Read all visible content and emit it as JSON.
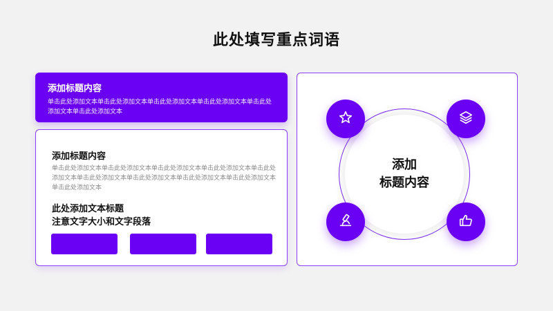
{
  "page": {
    "title": "此处填写重点词语"
  },
  "colors": {
    "accent": "#6a00f4",
    "border": "#8a3cf7",
    "background": "#f2f2f2"
  },
  "top_card": {
    "heading": "添加标题内容",
    "body": "单击此处添加文本单击此处添加文本单击此处添加文本单击此处添加文本单击此处添加文本单击此处添加文本"
  },
  "lower_card": {
    "heading": "添加标题内容",
    "body": "单击此处添加文本单击此处添加文本单击此处添加文本单击此处添加文本单击此处添加文本单击此处添加文本单击此处添加文本单击此处添加文本单击此处添加文本单击此处添加文本",
    "subheading_line1": "此处添加文本标题",
    "subheading_line2": "注意文字大小和文字段落"
  },
  "diagram": {
    "center_line1": "添加",
    "center_line2": "标题内容",
    "icons": [
      "star-icon",
      "layers-icon",
      "microscope-icon",
      "thumbs-up-icon"
    ]
  }
}
